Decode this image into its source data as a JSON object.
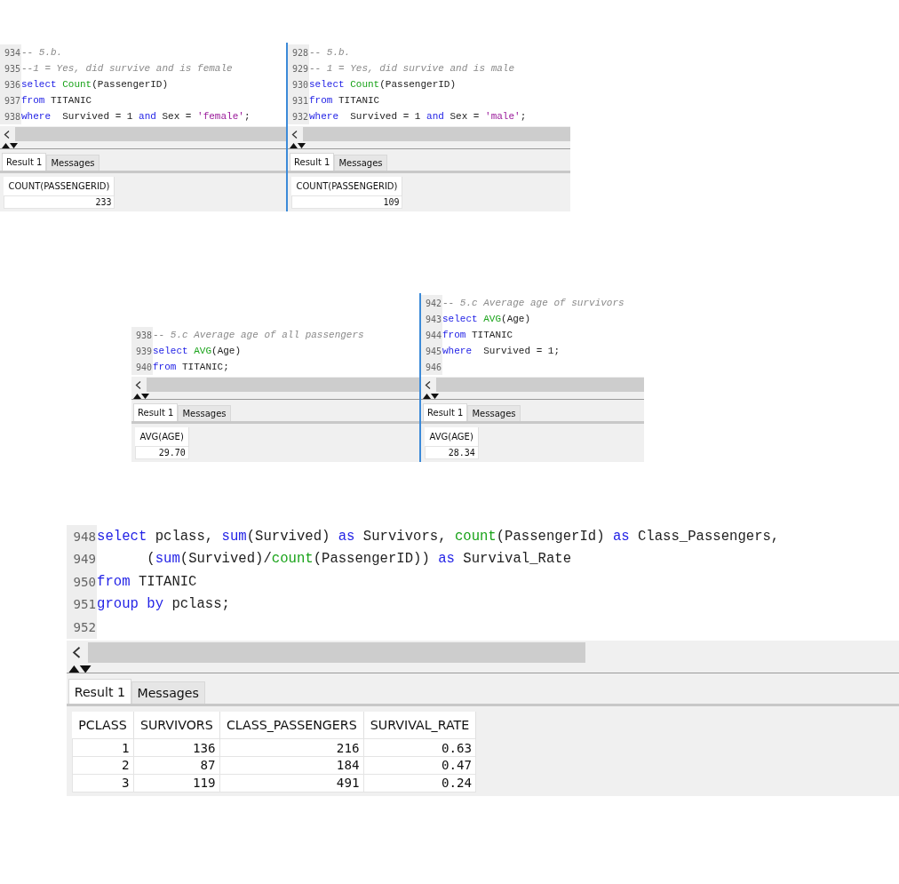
{
  "groups": [
    {
      "panels": [
        {
          "lines": [
            {
              "number": "934",
              "tokens": [
                {
                  "kind": "comment",
                  "text": "-- 5.b."
                }
              ]
            },
            {
              "number": "935",
              "tokens": [
                {
                  "kind": "comment",
                  "text": "--1 = Yes, did survive and is female"
                }
              ]
            },
            {
              "number": "936",
              "tokens": [
                {
                  "kind": "keyword",
                  "text": "select "
                },
                {
                  "kind": "function",
                  "text": "Count"
                },
                {
                  "kind": "plain",
                  "text": "(PassengerID)"
                }
              ]
            },
            {
              "number": "937",
              "tokens": [
                {
                  "kind": "keyword",
                  "text": "from "
                },
                {
                  "kind": "plain",
                  "text": "TITANIC"
                }
              ]
            },
            {
              "number": "938",
              "tokens": [
                {
                  "kind": "keyword",
                  "text": "where  "
                },
                {
                  "kind": "plain",
                  "text": "Survived = 1 "
                },
                {
                  "kind": "keyword",
                  "text": "and "
                },
                {
                  "kind": "plain",
                  "text": "Sex = "
                },
                {
                  "kind": "string",
                  "text": "'female'"
                },
                {
                  "kind": "plain",
                  "text": ";"
                }
              ]
            }
          ],
          "tabs": [
            {
              "label": "Result 1",
              "selected": true
            },
            {
              "label": "Messages",
              "selected": false
            }
          ],
          "result": {
            "columns": [
              "COUNT(PASSENGERID)"
            ],
            "rows": [
              [
                "233"
              ]
            ]
          }
        },
        {
          "lines": [
            {
              "number": "928",
              "tokens": [
                {
                  "kind": "comment",
                  "text": "-- 5.b."
                }
              ]
            },
            {
              "number": "929",
              "tokens": [
                {
                  "kind": "comment",
                  "text": "-- 1 = Yes, did survive and is male"
                }
              ]
            },
            {
              "number": "930",
              "tokens": [
                {
                  "kind": "keyword",
                  "text": "select "
                },
                {
                  "kind": "function",
                  "text": "Count"
                },
                {
                  "kind": "plain",
                  "text": "(PassengerID)"
                }
              ]
            },
            {
              "number": "931",
              "tokens": [
                {
                  "kind": "keyword",
                  "text": "from "
                },
                {
                  "kind": "plain",
                  "text": "TITANIC"
                }
              ]
            },
            {
              "number": "932",
              "tokens": [
                {
                  "kind": "keyword",
                  "text": "where  "
                },
                {
                  "kind": "plain",
                  "text": "Survived = 1 "
                },
                {
                  "kind": "keyword",
                  "text": "and "
                },
                {
                  "kind": "plain",
                  "text": "Sex = "
                },
                {
                  "kind": "string",
                  "text": "'male'"
                },
                {
                  "kind": "plain",
                  "text": ";"
                }
              ]
            }
          ],
          "tabs": [
            {
              "label": "Result 1",
              "selected": true
            },
            {
              "label": "Messages",
              "selected": false
            }
          ],
          "result": {
            "columns": [
              "COUNT(PASSENGERID)"
            ],
            "rows": [
              [
                "109"
              ]
            ]
          }
        }
      ]
    },
    {
      "panels": [
        {
          "lines": [
            {
              "number": "938",
              "tokens": [
                {
                  "kind": "comment",
                  "text": "-- 5.c Average age of all passengers"
                }
              ]
            },
            {
              "number": "939",
              "tokens": [
                {
                  "kind": "keyword",
                  "text": "select "
                },
                {
                  "kind": "function",
                  "text": "AVG"
                },
                {
                  "kind": "plain",
                  "text": "(Age)"
                }
              ]
            },
            {
              "number": "940",
              "tokens": [
                {
                  "kind": "keyword",
                  "text": "from "
                },
                {
                  "kind": "plain",
                  "text": "TITANIC;"
                }
              ]
            }
          ],
          "tabs": [
            {
              "label": "Result 1",
              "selected": true
            },
            {
              "label": "Messages",
              "selected": false
            }
          ],
          "result": {
            "columns": [
              "AVG(AGE)"
            ],
            "rows": [
              [
                "29.70"
              ]
            ]
          }
        },
        {
          "lines": [
            {
              "number": "942",
              "tokens": [
                {
                  "kind": "comment",
                  "text": "-- 5.c Average age of survivors"
                }
              ]
            },
            {
              "number": "943",
              "tokens": [
                {
                  "kind": "keyword",
                  "text": "select "
                },
                {
                  "kind": "function",
                  "text": "AVG"
                },
                {
                  "kind": "plain",
                  "text": "(Age)"
                }
              ]
            },
            {
              "number": "944",
              "tokens": [
                {
                  "kind": "keyword",
                  "text": "from "
                },
                {
                  "kind": "plain",
                  "text": "TITANIC"
                }
              ]
            },
            {
              "number": "945",
              "tokens": [
                {
                  "kind": "keyword",
                  "text": "where  "
                },
                {
                  "kind": "plain",
                  "text": "Survived = 1;"
                }
              ]
            },
            {
              "number": "946"
            }
          ],
          "tabs": [
            {
              "label": "Result 1",
              "selected": true
            },
            {
              "label": "Messages",
              "selected": false
            }
          ],
          "result": {
            "columns": [
              "AVG(AGE)"
            ],
            "rows": [
              [
                "28.34"
              ]
            ]
          }
        }
      ]
    },
    {
      "panels": [
        {
          "lines": [
            {
              "number": "948",
              "tokens": [
                {
                  "kind": "keyword",
                  "text": "select "
                },
                {
                  "kind": "plain",
                  "text": "pclass, "
                },
                {
                  "kind": "keyword",
                  "text": "sum"
                },
                {
                  "kind": "plain",
                  "text": "(Survived) "
                },
                {
                  "kind": "keyword",
                  "text": "as "
                },
                {
                  "kind": "plain",
                  "text": "Survivors, "
                },
                {
                  "kind": "function",
                  "text": "count"
                },
                {
                  "kind": "plain",
                  "text": "(PassengerId) "
                },
                {
                  "kind": "keyword",
                  "text": "as "
                },
                {
                  "kind": "plain",
                  "text": "Class_Passengers,"
                }
              ]
            },
            {
              "number": "949",
              "tokens": [
                {
                  "kind": "plain",
                  "text": "      ("
                },
                {
                  "kind": "keyword",
                  "text": "sum"
                },
                {
                  "kind": "plain",
                  "text": "(Survived)/"
                },
                {
                  "kind": "function",
                  "text": "count"
                },
                {
                  "kind": "plain",
                  "text": "(PassengerID)) "
                },
                {
                  "kind": "keyword",
                  "text": "as "
                },
                {
                  "kind": "plain",
                  "text": "Survival_Rate"
                }
              ]
            },
            {
              "number": "950",
              "tokens": [
                {
                  "kind": "keyword",
                  "text": "from "
                },
                {
                  "kind": "plain",
                  "text": "TITANIC"
                }
              ]
            },
            {
              "number": "951",
              "tokens": [
                {
                  "kind": "keyword",
                  "text": "group by "
                },
                {
                  "kind": "plain",
                  "text": "pclass;"
                }
              ]
            },
            {
              "number": "952"
            }
          ],
          "tabs": [
            {
              "label": "Result 1",
              "selected": true
            },
            {
              "label": "Messages",
              "selected": false
            }
          ],
          "result": {
            "columns": [
              "PCLASS",
              "SURVIVORS",
              "CLASS_PASSENGERS",
              "SURVIVAL_RATE"
            ],
            "rows": [
              [
                "1",
                "136",
                "216",
                "0.63"
              ],
              [
                "2",
                "87",
                "184",
                "0.47"
              ],
              [
                "3",
                "119",
                "491",
                "0.24"
              ]
            ]
          }
        }
      ]
    }
  ]
}
